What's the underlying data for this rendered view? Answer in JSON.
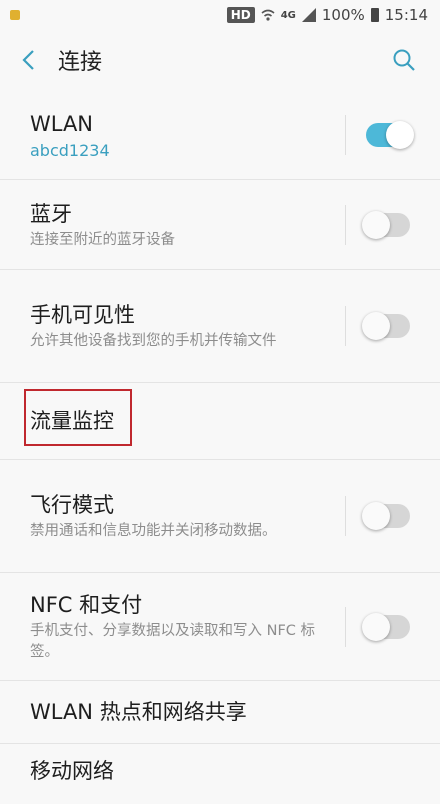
{
  "status_bar": {
    "hd": "HD",
    "network": "4G",
    "battery": "100%",
    "time": "15:14"
  },
  "header": {
    "title": "连接"
  },
  "items": [
    {
      "label": "WLAN",
      "sub": "abcd1234",
      "toggle": "on"
    },
    {
      "label": "蓝牙",
      "sub": "连接至附近的蓝牙设备",
      "toggle": "off"
    },
    {
      "label": "手机可见性",
      "sub": "允许其他设备找到您的手机并传输文件",
      "toggle": "off"
    },
    {
      "label": "流量监控"
    },
    {
      "label": "飞行模式",
      "sub": "禁用通话和信息功能并关闭移动数据。",
      "toggle": "off"
    },
    {
      "label": "NFC 和支付",
      "sub": "手机支付、分享数据以及读取和写入 NFC 标签。",
      "toggle": "off"
    },
    {
      "label": "WLAN 热点和网络共享"
    },
    {
      "label": "移动网络"
    }
  ],
  "colors": {
    "accent": "#4db8d8",
    "highlight_border": "#c0282e"
  }
}
